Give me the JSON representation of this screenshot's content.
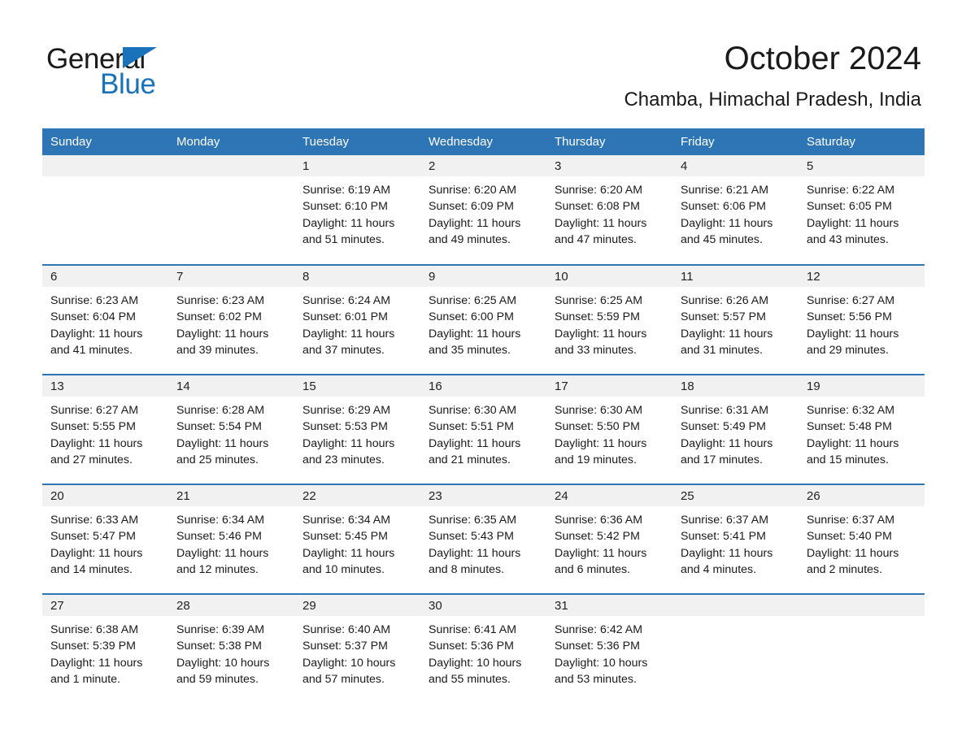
{
  "brand": {
    "name_part1": "General",
    "name_part2": "Blue",
    "accent_color": "#1a72ba"
  },
  "header": {
    "title": "October 2024",
    "location": "Chamba, Himachal Pradesh, India"
  },
  "calendar": {
    "header_bg": "#2e75b6",
    "daynum_bg": "#f1f1f1",
    "weekday_headers": [
      "Sunday",
      "Monday",
      "Tuesday",
      "Wednesday",
      "Thursday",
      "Friday",
      "Saturday"
    ],
    "weeks": [
      [
        {
          "day": "",
          "blank": true
        },
        {
          "day": "",
          "blank": true
        },
        {
          "day": "1",
          "sunrise": "Sunrise: 6:19 AM",
          "sunset": "Sunset: 6:10 PM",
          "daylight_line1": "Daylight: 11 hours",
          "daylight_line2": "and 51 minutes."
        },
        {
          "day": "2",
          "sunrise": "Sunrise: 6:20 AM",
          "sunset": "Sunset: 6:09 PM",
          "daylight_line1": "Daylight: 11 hours",
          "daylight_line2": "and 49 minutes."
        },
        {
          "day": "3",
          "sunrise": "Sunrise: 6:20 AM",
          "sunset": "Sunset: 6:08 PM",
          "daylight_line1": "Daylight: 11 hours",
          "daylight_line2": "and 47 minutes."
        },
        {
          "day": "4",
          "sunrise": "Sunrise: 6:21 AM",
          "sunset": "Sunset: 6:06 PM",
          "daylight_line1": "Daylight: 11 hours",
          "daylight_line2": "and 45 minutes."
        },
        {
          "day": "5",
          "sunrise": "Sunrise: 6:22 AM",
          "sunset": "Sunset: 6:05 PM",
          "daylight_line1": "Daylight: 11 hours",
          "daylight_line2": "and 43 minutes."
        }
      ],
      [
        {
          "day": "6",
          "sunrise": "Sunrise: 6:23 AM",
          "sunset": "Sunset: 6:04 PM",
          "daylight_line1": "Daylight: 11 hours",
          "daylight_line2": "and 41 minutes."
        },
        {
          "day": "7",
          "sunrise": "Sunrise: 6:23 AM",
          "sunset": "Sunset: 6:02 PM",
          "daylight_line1": "Daylight: 11 hours",
          "daylight_line2": "and 39 minutes."
        },
        {
          "day": "8",
          "sunrise": "Sunrise: 6:24 AM",
          "sunset": "Sunset: 6:01 PM",
          "daylight_line1": "Daylight: 11 hours",
          "daylight_line2": "and 37 minutes."
        },
        {
          "day": "9",
          "sunrise": "Sunrise: 6:25 AM",
          "sunset": "Sunset: 6:00 PM",
          "daylight_line1": "Daylight: 11 hours",
          "daylight_line2": "and 35 minutes."
        },
        {
          "day": "10",
          "sunrise": "Sunrise: 6:25 AM",
          "sunset": "Sunset: 5:59 PM",
          "daylight_line1": "Daylight: 11 hours",
          "daylight_line2": "and 33 minutes."
        },
        {
          "day": "11",
          "sunrise": "Sunrise: 6:26 AM",
          "sunset": "Sunset: 5:57 PM",
          "daylight_line1": "Daylight: 11 hours",
          "daylight_line2": "and 31 minutes."
        },
        {
          "day": "12",
          "sunrise": "Sunrise: 6:27 AM",
          "sunset": "Sunset: 5:56 PM",
          "daylight_line1": "Daylight: 11 hours",
          "daylight_line2": "and 29 minutes."
        }
      ],
      [
        {
          "day": "13",
          "sunrise": "Sunrise: 6:27 AM",
          "sunset": "Sunset: 5:55 PM",
          "daylight_line1": "Daylight: 11 hours",
          "daylight_line2": "and 27 minutes."
        },
        {
          "day": "14",
          "sunrise": "Sunrise: 6:28 AM",
          "sunset": "Sunset: 5:54 PM",
          "daylight_line1": "Daylight: 11 hours",
          "daylight_line2": "and 25 minutes."
        },
        {
          "day": "15",
          "sunrise": "Sunrise: 6:29 AM",
          "sunset": "Sunset: 5:53 PM",
          "daylight_line1": "Daylight: 11 hours",
          "daylight_line2": "and 23 minutes."
        },
        {
          "day": "16",
          "sunrise": "Sunrise: 6:30 AM",
          "sunset": "Sunset: 5:51 PM",
          "daylight_line1": "Daylight: 11 hours",
          "daylight_line2": "and 21 minutes."
        },
        {
          "day": "17",
          "sunrise": "Sunrise: 6:30 AM",
          "sunset": "Sunset: 5:50 PM",
          "daylight_line1": "Daylight: 11 hours",
          "daylight_line2": "and 19 minutes."
        },
        {
          "day": "18",
          "sunrise": "Sunrise: 6:31 AM",
          "sunset": "Sunset: 5:49 PM",
          "daylight_line1": "Daylight: 11 hours",
          "daylight_line2": "and 17 minutes."
        },
        {
          "day": "19",
          "sunrise": "Sunrise: 6:32 AM",
          "sunset": "Sunset: 5:48 PM",
          "daylight_line1": "Daylight: 11 hours",
          "daylight_line2": "and 15 minutes."
        }
      ],
      [
        {
          "day": "20",
          "sunrise": "Sunrise: 6:33 AM",
          "sunset": "Sunset: 5:47 PM",
          "daylight_line1": "Daylight: 11 hours",
          "daylight_line2": "and 14 minutes."
        },
        {
          "day": "21",
          "sunrise": "Sunrise: 6:34 AM",
          "sunset": "Sunset: 5:46 PM",
          "daylight_line1": "Daylight: 11 hours",
          "daylight_line2": "and 12 minutes."
        },
        {
          "day": "22",
          "sunrise": "Sunrise: 6:34 AM",
          "sunset": "Sunset: 5:45 PM",
          "daylight_line1": "Daylight: 11 hours",
          "daylight_line2": "and 10 minutes."
        },
        {
          "day": "23",
          "sunrise": "Sunrise: 6:35 AM",
          "sunset": "Sunset: 5:43 PM",
          "daylight_line1": "Daylight: 11 hours",
          "daylight_line2": "and 8 minutes."
        },
        {
          "day": "24",
          "sunrise": "Sunrise: 6:36 AM",
          "sunset": "Sunset: 5:42 PM",
          "daylight_line1": "Daylight: 11 hours",
          "daylight_line2": "and 6 minutes."
        },
        {
          "day": "25",
          "sunrise": "Sunrise: 6:37 AM",
          "sunset": "Sunset: 5:41 PM",
          "daylight_line1": "Daylight: 11 hours",
          "daylight_line2": "and 4 minutes."
        },
        {
          "day": "26",
          "sunrise": "Sunrise: 6:37 AM",
          "sunset": "Sunset: 5:40 PM",
          "daylight_line1": "Daylight: 11 hours",
          "daylight_line2": "and 2 minutes."
        }
      ],
      [
        {
          "day": "27",
          "sunrise": "Sunrise: 6:38 AM",
          "sunset": "Sunset: 5:39 PM",
          "daylight_line1": "Daylight: 11 hours",
          "daylight_line2": "and 1 minute."
        },
        {
          "day": "28",
          "sunrise": "Sunrise: 6:39 AM",
          "sunset": "Sunset: 5:38 PM",
          "daylight_line1": "Daylight: 10 hours",
          "daylight_line2": "and 59 minutes."
        },
        {
          "day": "29",
          "sunrise": "Sunrise: 6:40 AM",
          "sunset": "Sunset: 5:37 PM",
          "daylight_line1": "Daylight: 10 hours",
          "daylight_line2": "and 57 minutes."
        },
        {
          "day": "30",
          "sunrise": "Sunrise: 6:41 AM",
          "sunset": "Sunset: 5:36 PM",
          "daylight_line1": "Daylight: 10 hours",
          "daylight_line2": "and 55 minutes."
        },
        {
          "day": "31",
          "sunrise": "Sunrise: 6:42 AM",
          "sunset": "Sunset: 5:36 PM",
          "daylight_line1": "Daylight: 10 hours",
          "daylight_line2": "and 53 minutes."
        },
        {
          "day": "",
          "blank": true
        },
        {
          "day": "",
          "blank": true
        }
      ]
    ]
  }
}
